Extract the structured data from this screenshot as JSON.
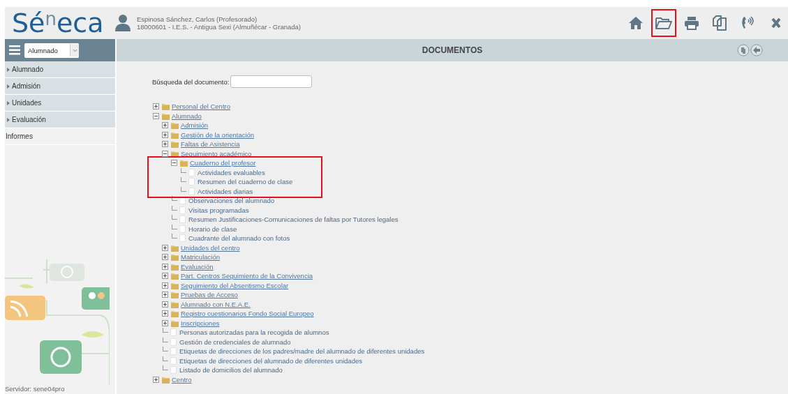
{
  "header": {
    "logo": "Sé$^{n}$eca",
    "user_name": "Espinosa Sánchez, Carlos (Profesorado)",
    "user_center": "18000601 - I.E.S. - Antigua Sexi (Almuñécar - Granada)",
    "toolbar": [
      {
        "kind": "home",
        "highlighted": false
      },
      {
        "kind": "folder",
        "highlighted": true
      },
      {
        "kind": "print",
        "highlighted": false
      },
      {
        "kind": "copy",
        "highlighted": false
      },
      {
        "kind": "phone",
        "highlighted": false
      },
      {
        "kind": "close",
        "highlighted": false
      }
    ]
  },
  "sidebar": {
    "module_select": "Alumnado",
    "items": [
      {
        "label": "Alumnado",
        "kind": "collapsible"
      },
      {
        "label": "Admisión",
        "kind": "collapsible"
      },
      {
        "label": "Unidades",
        "kind": "collapsible"
      },
      {
        "label": "Evaluación",
        "kind": "collapsible"
      },
      {
        "label": "Informes",
        "kind": "link"
      }
    ],
    "server": "Servidor: sene04pro"
  },
  "content": {
    "title": "DOCUMENTOS",
    "title_actions": [
      {
        "kind": "documents"
      },
      {
        "kind": "back"
      }
    ],
    "search_label": "Búsqueda del documento:",
    "tree": [
      {
        "label": "Personal del Centro",
        "kind": "folder",
        "expanded": false,
        "highlighted": false
      },
      {
        "label": "Alumnado",
        "kind": "folder",
        "expanded": true,
        "highlighted": false,
        "children": [
          {
            "label": "Admisión",
            "kind": "folder",
            "expanded": false,
            "highlighted": false
          },
          {
            "label": "Gestión de la orientación",
            "kind": "folder",
            "expanded": false,
            "highlighted": false
          },
          {
            "label": "Faltas de Asistencia",
            "kind": "folder",
            "expanded": false,
            "highlighted": false
          },
          {
            "label": "Seguimiento académico",
            "kind": "folder",
            "expanded": true,
            "highlighted": false,
            "children": [
              {
                "label": "Cuaderno del profesor",
                "kind": "folder",
                "expanded": true,
                "highlighted": true,
                "children": [
                  {
                    "label": "Actividades evaluables",
                    "kind": "document"
                  },
                  {
                    "label": "Resumen del cuaderno de clase",
                    "kind": "document"
                  },
                  {
                    "label": "Actividades diarias",
                    "kind": "document"
                  }
                ]
              },
              {
                "label": "Observaciones del alumnado",
                "kind": "document"
              },
              {
                "label": "Visitas programadas",
                "kind": "document"
              },
              {
                "label": "Resumen Justificaciones-Comunicaciones de faltas por Tutores legales",
                "kind": "document"
              },
              {
                "label": "Horario de clase",
                "kind": "document"
              },
              {
                "label": "Cuadrante del alumnado con fotos",
                "kind": "document"
              }
            ]
          },
          {
            "label": "Unidades del centro",
            "kind": "folder",
            "expanded": false,
            "highlighted": false
          },
          {
            "label": "Matriculación",
            "kind": "folder",
            "expanded": false,
            "highlighted": false
          },
          {
            "label": "Evaluación",
            "kind": "folder",
            "expanded": false,
            "highlighted": false
          },
          {
            "label": "Part. Centros Seguimiento de la Convivencia",
            "kind": "folder",
            "expanded": false,
            "highlighted": false
          },
          {
            "label": "Seguimiento del Absentismo Escolar",
            "kind": "folder",
            "expanded": false,
            "highlighted": false
          },
          {
            "label": "Pruebas de Acceso",
            "kind": "folder",
            "expanded": false,
            "highlighted": false
          },
          {
            "label": "Alumnado con N.E.A.E.",
            "kind": "folder",
            "expanded": false,
            "highlighted": false
          },
          {
            "label": "Registro cuestionarios Fondo Social Europeo",
            "kind": "folder",
            "expanded": false,
            "highlighted": false
          },
          {
            "label": "Inscripciones",
            "kind": "folder",
            "expanded": false,
            "highlighted": false
          },
          {
            "label": "Personas autorizadas para la recogida de alumnos",
            "kind": "document"
          },
          {
            "label": "Gestión de credenciales de alumnado",
            "kind": "document"
          },
          {
            "label": "Etiquetas de direcciones de los padres/madre del alumnado de diferentes unidades",
            "kind": "document"
          },
          {
            "label": "Etiquetas de direcciones del alumnado de diferentes unidades",
            "kind": "document"
          },
          {
            "label": "Listado de domicilios del alumnado",
            "kind": "document"
          }
        ]
      },
      {
        "label": "Centro",
        "kind": "folder",
        "expanded": false,
        "highlighted": false
      }
    ]
  }
}
